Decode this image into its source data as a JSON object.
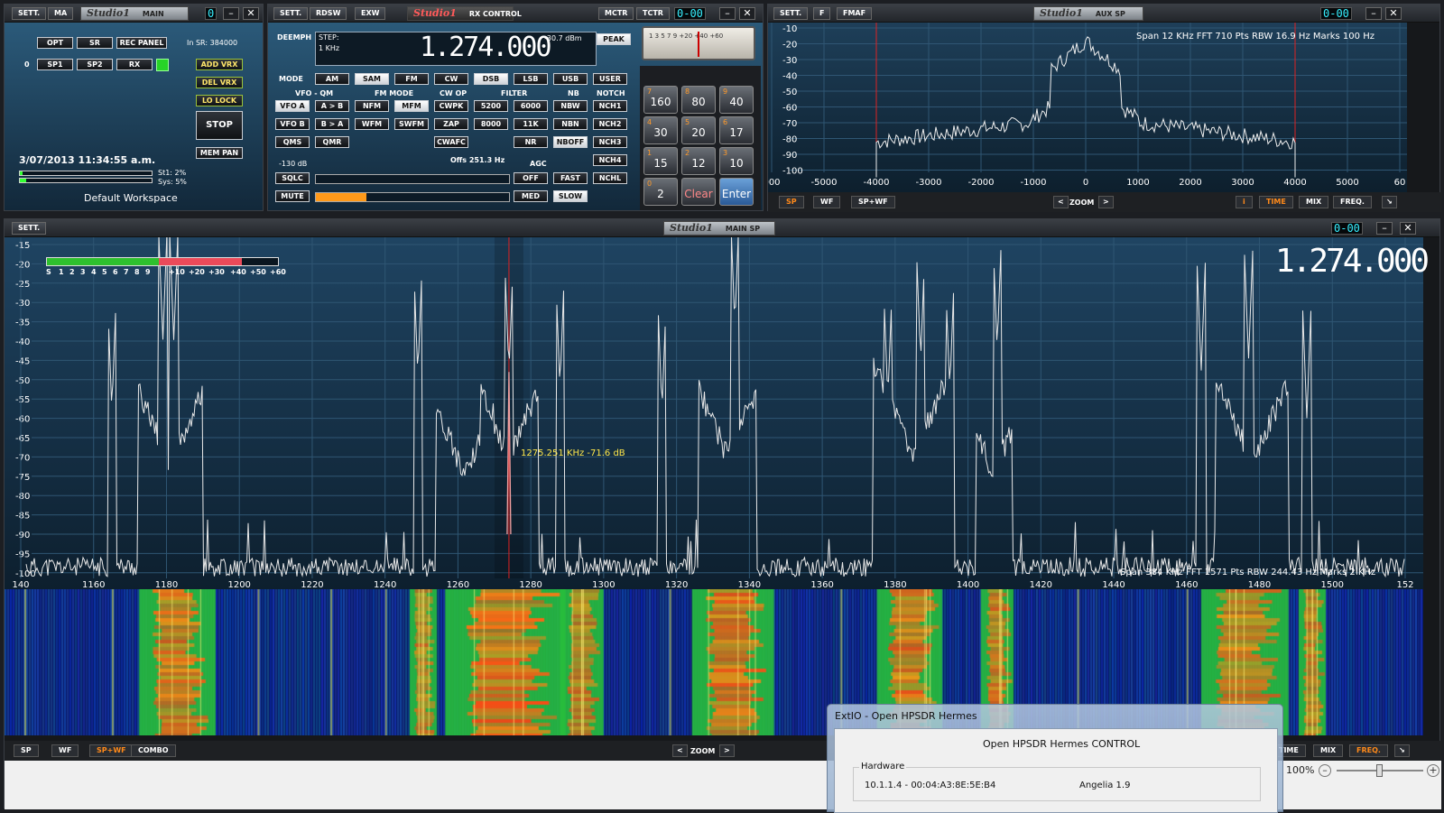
{
  "main_panel": {
    "sett": "SETT.",
    "ma": "MA",
    "logo": "Studio1",
    "title": "MAIN",
    "lcd": "0",
    "btn_opt": "OPT",
    "btn_sr": "SR",
    "btn_rec": "REC PANEL",
    "sr_text": "In SR: 384000",
    "rx_index": "0",
    "btn_sp1": "SP1",
    "btn_sp2": "SP2",
    "btn_rx": "RX",
    "btn_add": "ADD VRX",
    "btn_del": "DEL VRX",
    "btn_lo": "LO LOCK",
    "btn_stop": "STOP",
    "btn_mempan": "MEM PAN",
    "datetime": "3/07/2013 11:34:55 a.m.",
    "st1": "St1: 2%",
    "sys": "Sys: 5%",
    "workspace": "Default Workspace"
  },
  "rx_control": {
    "sett": "SETT.",
    "rdsw": "RDSW",
    "exw": "EXW",
    "logo": "Studio1",
    "title": "RX CONTROL",
    "mctr": "MCTR",
    "tctr": "TCTR",
    "lcd": "0-00",
    "deemph": "DEEMPH",
    "step_label": "STEP:",
    "step_value": "1 KHz",
    "freq": "1.274.000",
    "dbm": "-30.7 dBm",
    "peak": "PEAK",
    "mode_label": "MODE",
    "modes": [
      "AM",
      "SAM",
      "FM",
      "CW",
      "DSB",
      "LSB",
      "USB",
      "USER"
    ],
    "vfo_label": "VFO - QM",
    "fm_mode_label": "FM MODE",
    "cw_op_label": "CW OP",
    "filter_label": "FILTER",
    "nb_label": "NB",
    "notch_label": "NOTCH",
    "row1": [
      "VFO A",
      "A > B",
      "NFM",
      "MFM",
      "CWPK",
      "5200",
      "6000",
      "NBW",
      "NCH1"
    ],
    "row2": [
      "VFO B",
      "B > A",
      "WFM",
      "SWFM",
      "ZAP",
      "8000",
      "11K",
      "NBN",
      "NCH2"
    ],
    "row3": [
      "QMS",
      "QMR",
      "CWAFC",
      "NR",
      "NBOFF",
      "NCH3"
    ],
    "offs": "Offs 251.3 Hz",
    "agc_label": "AGC",
    "nch4": "NCH4",
    "db130": "-130 dB",
    "sqlc": "SQLC",
    "agc_off": "OFF",
    "agc_fast": "FAST",
    "nchl": "NCHL",
    "mute": "MUTE",
    "agc_med": "MED",
    "agc_slow": "SLOW",
    "meter_scale": "1 3 5 7 9 +20 +40 +60",
    "keypad": [
      {
        "sup": "7",
        "label": "160"
      },
      {
        "sup": "8",
        "label": "80"
      },
      {
        "sup": "9",
        "label": "40"
      },
      {
        "sup": "4",
        "label": "30"
      },
      {
        "sup": "5",
        "label": "20"
      },
      {
        "sup": "6",
        "label": "17"
      },
      {
        "sup": "1",
        "label": "15"
      },
      {
        "sup": "2",
        "label": "12"
      },
      {
        "sup": "3",
        "label": "10"
      },
      {
        "sup": "0",
        "label": "2"
      },
      {
        "sup": "",
        "label": "Clear"
      },
      {
        "sup": "",
        "label": "Enter"
      }
    ]
  },
  "aux_sp": {
    "sett": "SETT.",
    "f": "F",
    "fmaf": "FMAF",
    "logo": "Studio1",
    "title": "AUX SP",
    "lcd": "0-00",
    "info": "Span 12 KHz   FFT 710 Pts   RBW 16.9 Hz   Marks 100 Hz",
    "yticks": [
      "-10",
      "-20",
      "-30",
      "-40",
      "-50",
      "-60",
      "-70",
      "-80",
      "-90",
      "-100"
    ],
    "xticks": [
      "000",
      "-5000",
      "-4000",
      "-3000",
      "-2000",
      "-1000",
      "0",
      "1000",
      "2000",
      "3000",
      "4000",
      "5000",
      "60"
    ],
    "btn_sp": "SP",
    "btn_wf": "WF",
    "btn_spwf": "SP+WF",
    "zoom": "ZOOM",
    "btn_i": "i",
    "btn_time": "TIME",
    "btn_mix": "MIX",
    "btn_freq": "FREQ."
  },
  "main_sp": {
    "sett": "SETT.",
    "logo": "Studio1",
    "title": "MAIN SP",
    "lcd": "0-00",
    "big_freq": "1.274.000",
    "smeter_labels": [
      "S",
      "1",
      "2",
      "3",
      "4",
      "5",
      "6",
      "7",
      "8",
      "9",
      "+10",
      "+20",
      "+30",
      "+40",
      "+50",
      "+60"
    ],
    "yticks": [
      "-15",
      "-20",
      "-25",
      "-30",
      "-35",
      "-40",
      "-45",
      "-50",
      "-55",
      "-60",
      "-65",
      "-70",
      "-75",
      "-80",
      "-85",
      "-90",
      "-95",
      "-100"
    ],
    "xticks": [
      "140",
      "1160",
      "1180",
      "1200",
      "1220",
      "1240",
      "1260",
      "1280",
      "1300",
      "1320",
      "1340",
      "1360",
      "1380",
      "1400",
      "1420",
      "1440",
      "1460",
      "1480",
      "1500",
      "152"
    ],
    "info": "Span 384 KHz   FFT 1571 Pts   RBW 244.43 Hz   Marks 2 KHz",
    "cursor": "1275.251 KHz -71.6 dB",
    "btn_sp": "SP",
    "btn_wf": "WF",
    "btn_spwf": "SP+WF",
    "btn_combo": "COMBO",
    "zoom": "ZOOM",
    "btn_time": "TIME",
    "btn_mix": "MIX",
    "btn_freq": "FREQ.",
    "zoom_pct": "100%"
  },
  "extio": {
    "title": "ExtIO - Open HPSDR Hermes",
    "header": "Open HPSDR Hermes CONTROL",
    "group": "Hardware",
    "address": "10.1.1.4 - 00:04:A3:8E:5E:B4",
    "firmware": "Angelia 1.9"
  }
}
